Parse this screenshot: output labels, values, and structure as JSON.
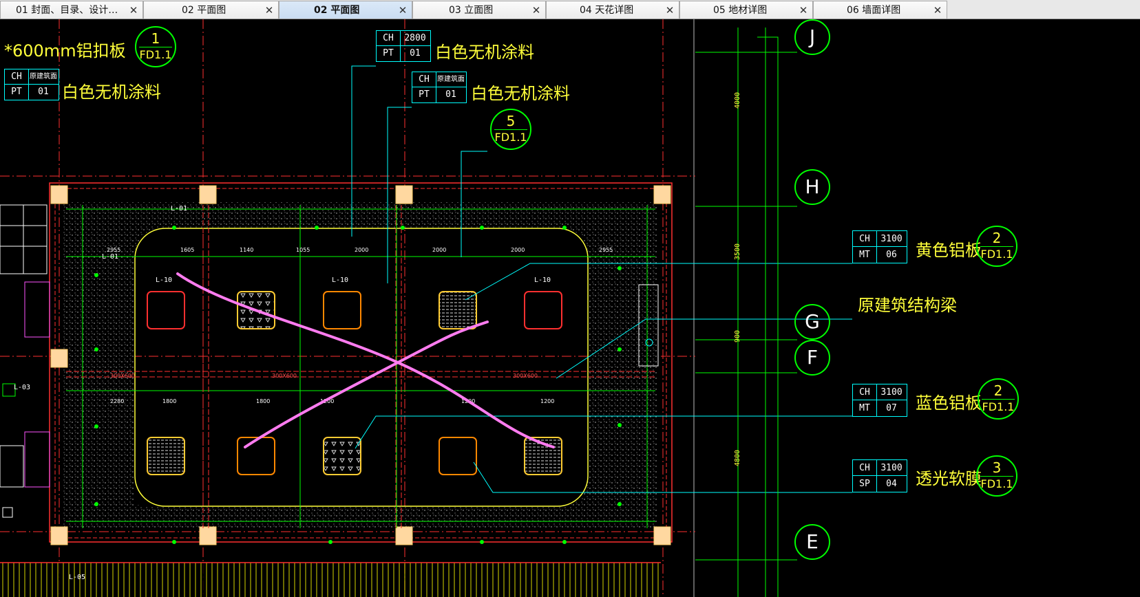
{
  "tabs": [
    {
      "label": "01 封面、目录、设计…",
      "close": "✕",
      "active": false
    },
    {
      "label": "02 平面图",
      "close": "✕",
      "active": false
    },
    {
      "label": "02 平面图",
      "close": "✕",
      "active": true
    },
    {
      "label": "03 立面图",
      "close": "✕",
      "active": false
    },
    {
      "label": "04 天花详图",
      "close": "✕",
      "active": false
    },
    {
      "label": "05 地材详图",
      "close": "✕",
      "active": false
    },
    {
      "label": "06 墙面详图",
      "close": "✕",
      "active": false
    }
  ],
  "annotations": {
    "aluminum_note": "*600mm铝扣板",
    "white_paint_1": "白色无机涂料",
    "white_paint_2": "白色无机涂料",
    "white_paint_3": "白色无机涂料",
    "yellow_aluminum": "黄色铝板",
    "structure_beam": "原建筑结构梁",
    "blue_aluminum": "蓝色铝板",
    "translucent_film": "透光软膜"
  },
  "tags": {
    "tag_a": {
      "r1c1": "CH",
      "r1c2": "原建筑面",
      "r2c1": "PT",
      "r2c2": "01"
    },
    "tag_b": {
      "r1c1": "CH",
      "r1c2": "2800",
      "r2c1": "PT",
      "r2c2": "01"
    },
    "tag_c": {
      "r1c1": "CH",
      "r1c2": "原建筑面",
      "r2c1": "PT",
      "r2c2": "01"
    },
    "tag_yellow": {
      "r1c1": "CH",
      "r1c2": "3100",
      "r2c1": "MT",
      "r2c2": "06"
    },
    "tag_blue": {
      "r1c1": "CH",
      "r1c2": "3100",
      "r2c1": "MT",
      "r2c2": "07"
    },
    "tag_film": {
      "r1c1": "CH",
      "r1c2": "3100",
      "r2c1": "SP",
      "r2c2": "04"
    }
  },
  "detail_bubbles": {
    "b1": {
      "num": "1",
      "ref": "FD1.1"
    },
    "b5": {
      "num": "5",
      "ref": "FD1.1"
    },
    "b2a": {
      "num": "2",
      "ref": "FD1.1"
    },
    "b2b": {
      "num": "2",
      "ref": "FD1.1"
    },
    "b3": {
      "num": "3",
      "ref": "FD1.1"
    }
  },
  "grid_axes": {
    "J": "J",
    "H": "H",
    "G": "G",
    "F": "F",
    "E": "E"
  },
  "dims_right": {
    "d1": "4000",
    "d2": "3500",
    "d3": "900",
    "d4": "4800"
  },
  "light_labels": {
    "l1": "L-01",
    "l10": "L-10",
    "l03": "L-03",
    "l05": "L-05"
  },
  "colors": {
    "cad_bg": "#000000",
    "green": "#00ff00",
    "cyan": "#00ffff",
    "red": "#ff2a2a",
    "yellow": "#ffff3a",
    "magenta": "#ff7cf0",
    "grid_red": "#ff3030"
  }
}
